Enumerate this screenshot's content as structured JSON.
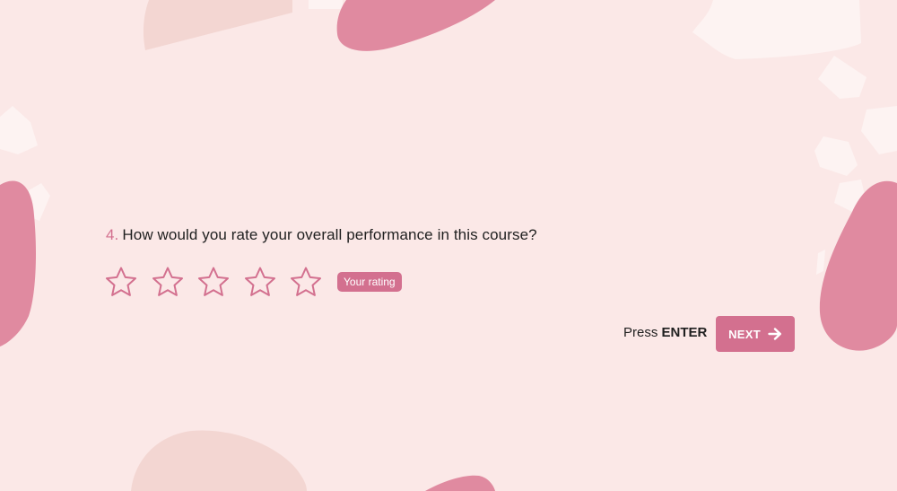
{
  "colors": {
    "background": "#fbe8e7",
    "accent": "#d3708f",
    "blob_dark": "#e08aa0",
    "blob_light": "#f3d6d2",
    "blob_white": "#fdf3f2"
  },
  "question": {
    "number": "4.",
    "text": "How would you rate your overall performance in this course?"
  },
  "rating": {
    "max_stars": 5,
    "selected": 0,
    "star_icon": "star-outline-icon",
    "badge_label": "Your rating"
  },
  "footer": {
    "press_label": "Press",
    "key_label": "ENTER",
    "next_label": "NEXT",
    "next_icon": "arrow-right-icon"
  }
}
